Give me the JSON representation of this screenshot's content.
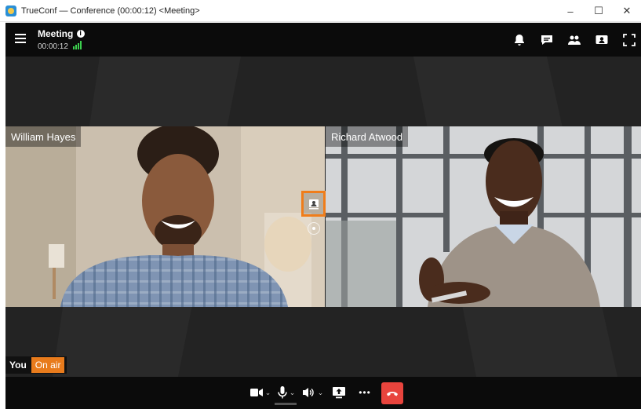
{
  "window": {
    "title": "TrueConf — Conference (00:00:12) <Meeting>",
    "minimize_glyph": "–",
    "maximize_glyph": "☐",
    "close_glyph": "✕"
  },
  "header": {
    "meeting_name": "Meeting",
    "elapsed": "00:00:12",
    "icons": [
      "bell-icon",
      "chat-icon",
      "participants-icon",
      "self-view-icon",
      "fullscreen-icon"
    ]
  },
  "stage": {
    "participants": [
      {
        "name": "William Hayes"
      },
      {
        "name": "Richard Atwood"
      }
    ],
    "self": {
      "label": "You",
      "status": "On air"
    }
  },
  "toolbar": {
    "icons": [
      "camera-icon",
      "microphone-icon",
      "speaker-icon",
      "share-screen-icon",
      "more-icon",
      "end-call-icon"
    ],
    "more_glyph": "•••",
    "caret_glyph": "⌄"
  },
  "colors": {
    "accent": "#f07d1a",
    "on_air": "#e87b1c",
    "end_call": "#e8443d",
    "signal": "#3ccf4e",
    "bar_background": "#0b0b0b"
  }
}
